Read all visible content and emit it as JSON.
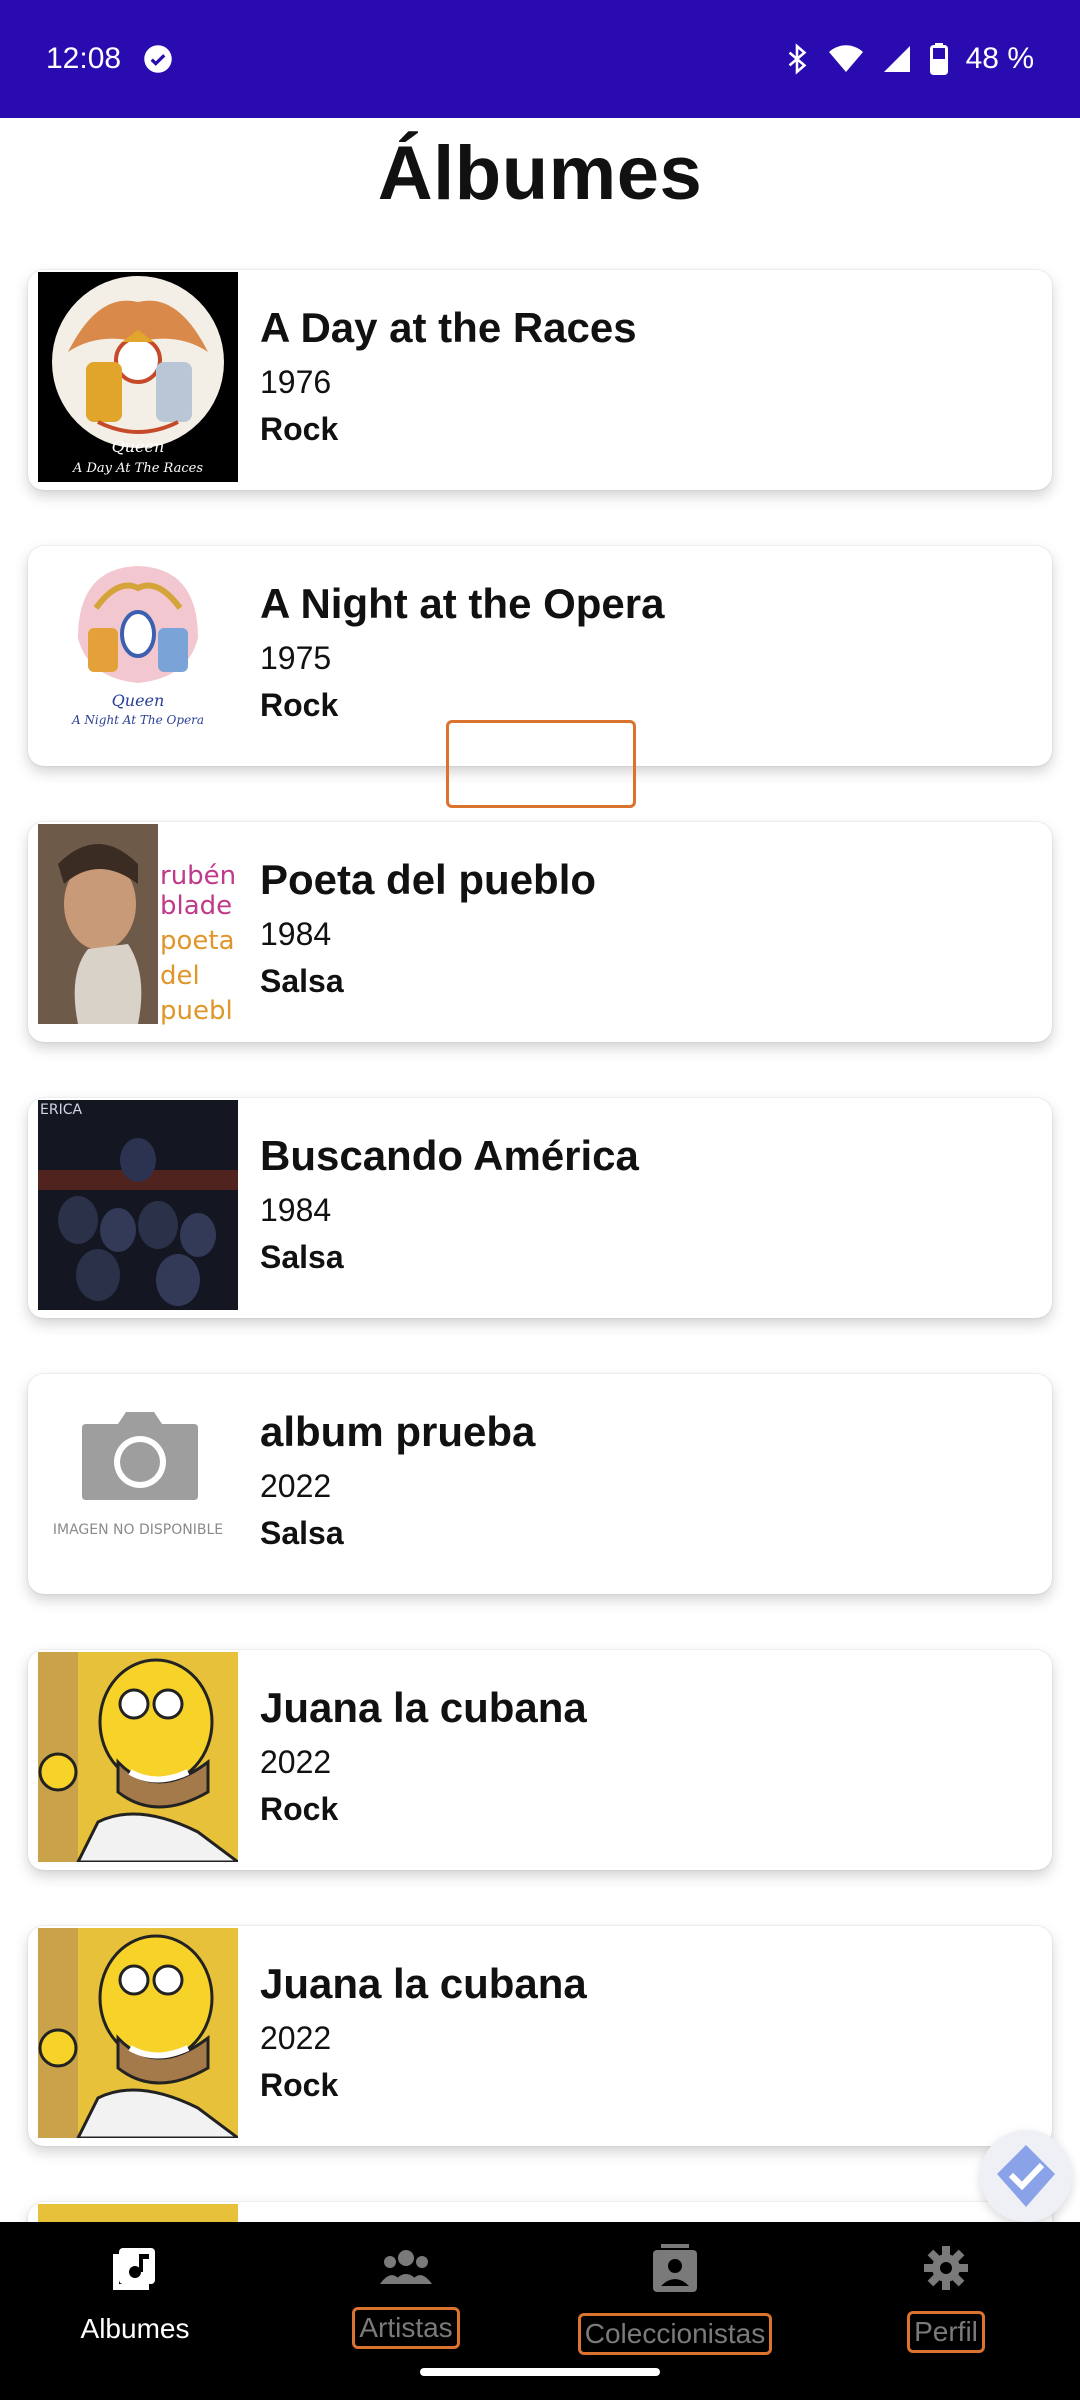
{
  "status_bar": {
    "time": "12:08",
    "battery": "48 %"
  },
  "page_title": "Álbumes",
  "albums": [
    {
      "title": "A Day at the Races",
      "year": "1976",
      "genre": "Rock",
      "cover": "queen-day-races-icon"
    },
    {
      "title": "A Night at the Opera",
      "year": "1975",
      "genre": "Rock",
      "cover": "queen-night-opera-icon"
    },
    {
      "title": "Poeta del pueblo",
      "year": "1984",
      "genre": "Salsa",
      "cover": "poeta-pueblo-icon",
      "cover_text": [
        "rubén",
        "blade",
        "poeta",
        "del",
        "puebl"
      ]
    },
    {
      "title": "Buscando América",
      "year": "1984",
      "genre": "Salsa",
      "cover": "buscando-america-icon",
      "cover_text": "ERICA"
    },
    {
      "title": "album prueba",
      "year": "2022",
      "genre": "Salsa",
      "cover": "camera-placeholder-icon",
      "cover_text": "IMAGEN NO DISPONIBLE"
    },
    {
      "title": "Juana la cubana",
      "year": "2022",
      "genre": "Rock",
      "cover": "simpsons-cover-icon"
    },
    {
      "title": "Juana la cubana",
      "year": "2022",
      "genre": "Rock",
      "cover": "simpsons-cover-icon"
    }
  ],
  "nav": {
    "items": [
      {
        "label": "Albumes",
        "icon": "music-note-icon",
        "active": true
      },
      {
        "label": "Artistas",
        "icon": "people-icon",
        "active": false
      },
      {
        "label": "Coleccionistas",
        "icon": "contact-card-icon",
        "active": false
      },
      {
        "label": "Perfil",
        "icon": "gear-icon",
        "active": false
      }
    ]
  },
  "colors": {
    "status_bar": "#2a0bb0",
    "nav_bar": "#000000",
    "highlight": "#d9732e"
  }
}
